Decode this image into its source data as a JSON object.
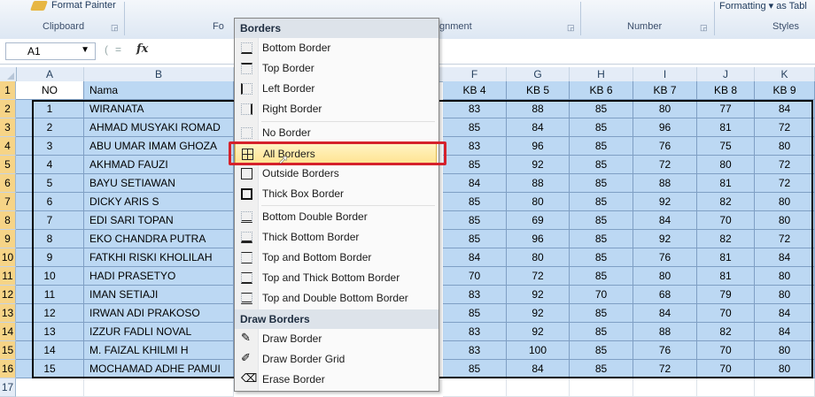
{
  "ribbon": {
    "format_painter": "Format Painter",
    "right_top": "Formatting ▾ as Tabl",
    "groups": [
      "Clipboard",
      "Fo",
      "gnment",
      "Number",
      "Styles"
    ]
  },
  "formula_bar": {
    "name_box": "A1",
    "fx": "fx"
  },
  "columns": [
    "A",
    "B",
    "F",
    "G",
    "H",
    "I",
    "J",
    "K"
  ],
  "row_numbers": [
    "1",
    "2",
    "3",
    "4",
    "5",
    "6",
    "7",
    "8",
    "9",
    "10",
    "11",
    "12",
    "13",
    "14",
    "15",
    "16",
    "17"
  ],
  "table": {
    "headers": {
      "no": "NO",
      "nama": "Nama",
      "f": "KB 4",
      "g": "KB 5",
      "h": "KB 6",
      "i": "KB 7",
      "j": "KB 8",
      "k": "KB 9"
    },
    "rows": [
      {
        "no": "1",
        "nama": "WIRANATA",
        "f": "83",
        "g": "88",
        "h": "85",
        "i": "80",
        "j": "77",
        "k": "84"
      },
      {
        "no": "2",
        "nama": "AHMAD MUSYAKI ROMAD",
        "f": "85",
        "g": "84",
        "h": "85",
        "i": "96",
        "j": "81",
        "k": "72"
      },
      {
        "no": "3",
        "nama": "ABU UMAR IMAM GHOZA",
        "f": "83",
        "g": "96",
        "h": "85",
        "i": "76",
        "j": "75",
        "k": "80"
      },
      {
        "no": "4",
        "nama": "AKHMAD FAUZI",
        "f": "85",
        "g": "92",
        "h": "85",
        "i": "72",
        "j": "80",
        "k": "72"
      },
      {
        "no": "5",
        "nama": "BAYU SETIAWAN",
        "f": "84",
        "g": "88",
        "h": "85",
        "i": "88",
        "j": "81",
        "k": "72"
      },
      {
        "no": "6",
        "nama": "DICKY ARIS S",
        "f": "85",
        "g": "80",
        "h": "85",
        "i": "92",
        "j": "82",
        "k": "80"
      },
      {
        "no": "7",
        "nama": "EDI SARI TOPAN",
        "f": "85",
        "g": "69",
        "h": "85",
        "i": "84",
        "j": "70",
        "k": "80"
      },
      {
        "no": "8",
        "nama": "EKO CHANDRA PUTRA",
        "f": "85",
        "g": "96",
        "h": "85",
        "i": "92",
        "j": "82",
        "k": "72"
      },
      {
        "no": "9",
        "nama": "FATKHI RISKI KHOLILAH",
        "f": "84",
        "g": "80",
        "h": "85",
        "i": "76",
        "j": "81",
        "k": "84"
      },
      {
        "no": "10",
        "nama": "HADI PRASETYO",
        "f": "70",
        "g": "72",
        "h": "85",
        "i": "80",
        "j": "81",
        "k": "80"
      },
      {
        "no": "11",
        "nama": "IMAN SETIAJI",
        "f": "83",
        "g": "92",
        "h": "70",
        "i": "68",
        "j": "79",
        "k": "80"
      },
      {
        "no": "12",
        "nama": "IRWAN ADI PRAKOSO",
        "f": "85",
        "g": "92",
        "h": "85",
        "i": "84",
        "j": "70",
        "k": "84"
      },
      {
        "no": "13",
        "nama": "IZZUR FADLI NOVAL",
        "f": "83",
        "g": "92",
        "h": "85",
        "i": "88",
        "j": "82",
        "k": "84"
      },
      {
        "no": "14",
        "nama": "M. FAIZAL KHILMI H",
        "f": "83",
        "g": "100",
        "h": "85",
        "i": "76",
        "j": "70",
        "k": "80"
      },
      {
        "no": "15",
        "nama": "MOCHAMAD ADHE PAMUI",
        "f": "85",
        "g": "84",
        "h": "85",
        "i": "72",
        "j": "70",
        "k": "80"
      }
    ]
  },
  "borders_menu": {
    "title": "Borders",
    "items": [
      {
        "label": "Bottom Border",
        "icon": "bottom-border-icon"
      },
      {
        "label": "Top Border",
        "icon": "top-border-icon"
      },
      {
        "label": "Left Border",
        "icon": "left-border-icon"
      },
      {
        "label": "Right Border",
        "icon": "right-border-icon"
      },
      {
        "label": "No Border",
        "icon": "no-border-icon"
      },
      {
        "label": "All Borders",
        "icon": "all-borders-icon"
      },
      {
        "label": "Outside Borders",
        "icon": "outside-borders-icon"
      },
      {
        "label": "Thick Box Border",
        "icon": "thick-box-border-icon"
      },
      {
        "label": "Bottom Double Border",
        "icon": "bottom-double-border-icon"
      },
      {
        "label": "Thick Bottom Border",
        "icon": "thick-bottom-border-icon"
      },
      {
        "label": "Top and Bottom Border",
        "icon": "top-bottom-border-icon"
      },
      {
        "label": "Top and Thick Bottom Border",
        "icon": "top-thick-bottom-border-icon"
      },
      {
        "label": "Top and Double Bottom Border",
        "icon": "top-double-bottom-border-icon"
      }
    ],
    "draw_title": "Draw Borders",
    "draw_items": [
      {
        "label": "Draw Border",
        "icon": "pencil-icon"
      },
      {
        "label": "Draw Border Grid",
        "icon": "pencil-grid-icon"
      },
      {
        "label": "Erase Border",
        "icon": "eraser-icon"
      }
    ]
  },
  "colors": {
    "selection": "#bcd8f3",
    "highlight": "#ffe493",
    "callout": "#d5212b"
  }
}
